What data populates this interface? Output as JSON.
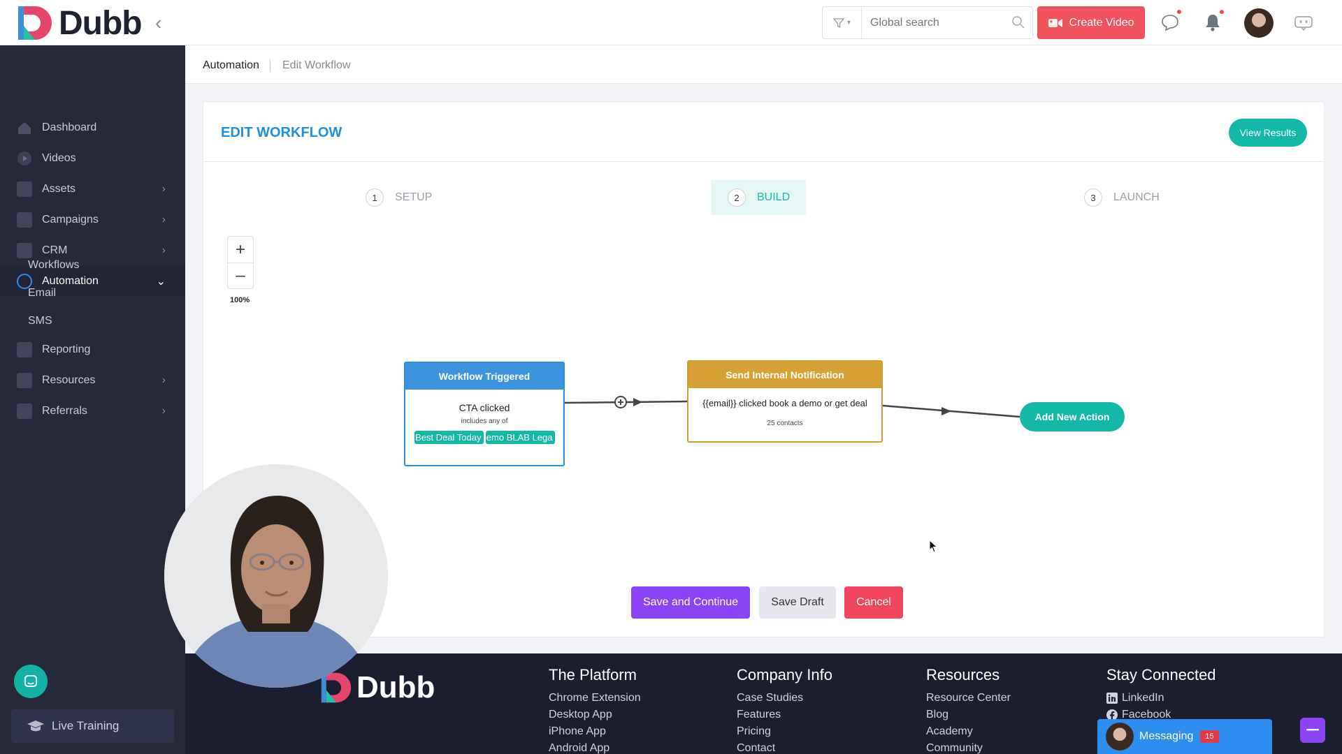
{
  "app": {
    "logo_text": "Dubb",
    "brand_colors": {
      "primary": "#1f8fe6",
      "teal": "#14b8a6",
      "red": "#f0535c",
      "purple": "#8b45f6"
    }
  },
  "topbar": {
    "search_placeholder": "Global search",
    "create_video_label": "Create Video",
    "icons": [
      "filter-icon",
      "search-icon",
      "chat-icon",
      "bell-icon",
      "avatar",
      "bot-icon"
    ]
  },
  "sidebar": {
    "items": [
      {
        "label": "Dashboard",
        "icon": "home-icon",
        "has_chevron": false
      },
      {
        "label": "Videos",
        "icon": "play-icon",
        "has_chevron": false
      },
      {
        "label": "Assets",
        "icon": "assets-icon",
        "has_chevron": true
      },
      {
        "label": "Campaigns",
        "icon": "campaign-icon",
        "has_chevron": true
      },
      {
        "label": "CRM",
        "icon": "crm-icon",
        "has_chevron": true
      },
      {
        "label": "Automation",
        "icon": "automation-icon",
        "has_chevron": true,
        "expanded": true
      },
      {
        "label": "Reporting",
        "icon": "reporting-icon",
        "has_chevron": false
      },
      {
        "label": "Resources",
        "icon": "resources-icon",
        "has_chevron": true
      },
      {
        "label": "Referrals",
        "icon": "referrals-icon",
        "has_chevron": true
      }
    ],
    "sub_items": [
      "Workflows",
      "Email",
      "SMS"
    ],
    "live_training": "Live Training"
  },
  "breadcrumb": {
    "root": "Automation",
    "current": "Edit Workflow"
  },
  "editor": {
    "title": "EDIT WORKFLOW",
    "view_results": "View Results",
    "steps": [
      {
        "num": "1",
        "label": "SETUP",
        "active": false
      },
      {
        "num": "2",
        "label": "BUILD",
        "active": true
      },
      {
        "num": "3",
        "label": "LAUNCH",
        "active": false
      }
    ],
    "zoom": {
      "plus": "+",
      "minus": "–",
      "level": "100%"
    },
    "trigger_node": {
      "title": "Workflow Triggered",
      "event": "CTA clicked",
      "qualifier": "includes any of",
      "tags": [
        "Best Deal Today",
        "Demo BLAB Lega"
      ]
    },
    "notify_node": {
      "title": "Send Internal Notification",
      "message": "{{email}} clicked book a demo or get deal",
      "contacts": "25 contacts"
    },
    "add_action": "Add New Action",
    "buttons": {
      "save_continue": "Save and Continue",
      "save_draft": "Save Draft",
      "cancel": "Cancel"
    }
  },
  "footer": {
    "logo_text": "Dubb",
    "columns": [
      {
        "title": "The Platform",
        "links": [
          "Chrome Extension",
          "Desktop App",
          "iPhone App",
          "Android App"
        ]
      },
      {
        "title": "Company Info",
        "links": [
          "Case Studies",
          "Features",
          "Pricing",
          "Contact"
        ]
      },
      {
        "title": "Resources",
        "links": [
          "Resource Center",
          "Blog",
          "Academy",
          "Community"
        ]
      },
      {
        "title": "Stay Connected",
        "links": [
          "LinkedIn",
          "Facebook"
        ]
      }
    ]
  },
  "messaging": {
    "label": "Messaging",
    "count": "15"
  }
}
